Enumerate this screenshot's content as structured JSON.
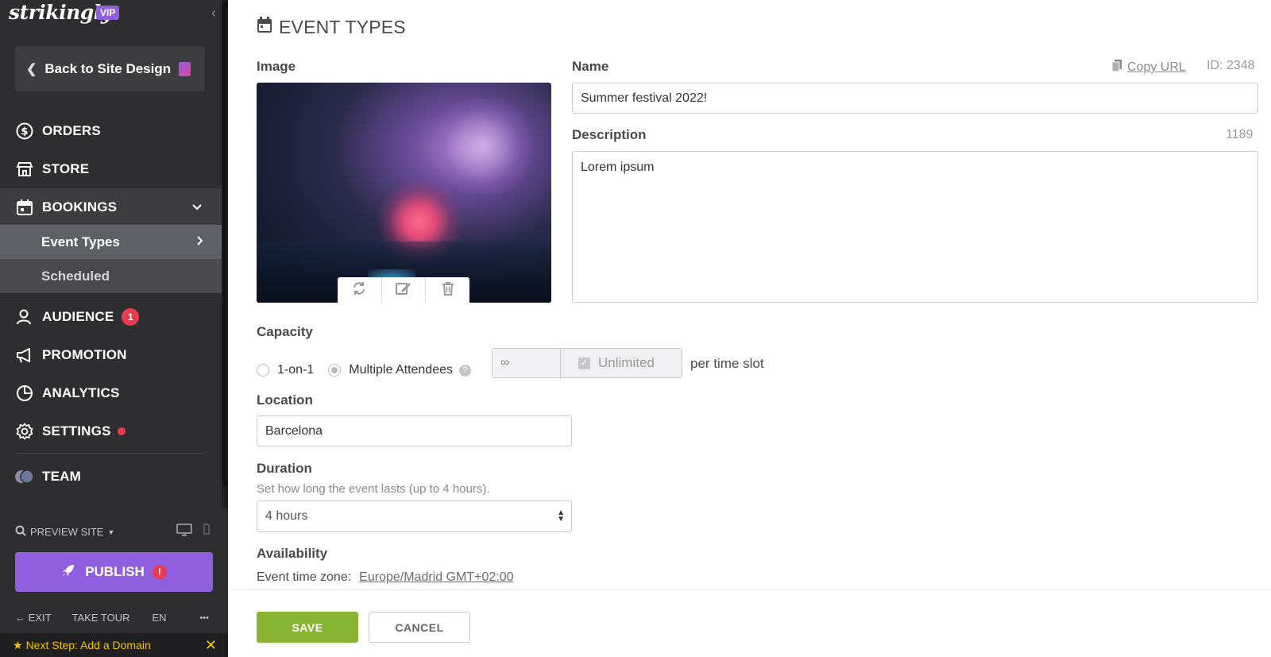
{
  "sidebar": {
    "logo": "strikingly",
    "vip_badge": "VIP",
    "back_label": "Back to Site Design",
    "nav": [
      {
        "label": "ORDERS",
        "icon": "dollar-circle-icon"
      },
      {
        "label": "STORE",
        "icon": "store-icon"
      },
      {
        "label": "BOOKINGS",
        "icon": "calendar-icon"
      },
      {
        "label": "AUDIENCE",
        "icon": "users-icon",
        "badge": "1"
      },
      {
        "label": "PROMOTION",
        "icon": "megaphone-icon"
      },
      {
        "label": "ANALYTICS",
        "icon": "pie-chart-icon"
      },
      {
        "label": "SETTINGS",
        "icon": "gear-icon"
      },
      {
        "label": "TEAM",
        "icon": "team-avatar-icon"
      }
    ],
    "bookings_sub": [
      {
        "label": "Event Types",
        "active": true
      },
      {
        "label": "Scheduled",
        "active": false
      }
    ],
    "preview_label": "PREVIEW SITE",
    "publish_label": "PUBLISH",
    "publish_warning": "!",
    "footer": {
      "exit": "EXIT",
      "tour": "TAKE TOUR",
      "lang": "EN",
      "more": "•••"
    },
    "next_step": "Next Step: Add a Domain"
  },
  "main": {
    "title": "EVENT TYPES",
    "image_label": "Image",
    "name_label": "Name",
    "copy_url": "Copy URL",
    "id_text": "ID: 2348",
    "name_value": "Summer festival 2022!",
    "description_label": "Description",
    "description_count": "1189",
    "description_value": "Lorem ipsum",
    "capacity_label": "Capacity",
    "capacity_one": "1-on-1",
    "capacity_multi": "Multiple Attendees",
    "capacity_selected": "Multiple Attendees",
    "capacity_value": "∞",
    "unlimited_label": "Unlimited",
    "per_slot": "per time slot",
    "location_label": "Location",
    "location_value": "Barcelona",
    "duration_label": "Duration",
    "duration_hint": "Set how long the event lasts (up to 4 hours).",
    "duration_value": "4 hours",
    "availability_label": "Availability",
    "timezone_label": "Event time zone:",
    "timezone_value": "Europe/Madrid GMT+02:00",
    "save_label": "SAVE",
    "cancel_label": "CANCEL"
  },
  "colors": {
    "sidebar_bg": "#2e2e30",
    "accent_purple": "#8f5fe0",
    "save_green": "#88b431",
    "alert_red": "#e83c4e",
    "next_step_yellow": "#f5c400"
  }
}
